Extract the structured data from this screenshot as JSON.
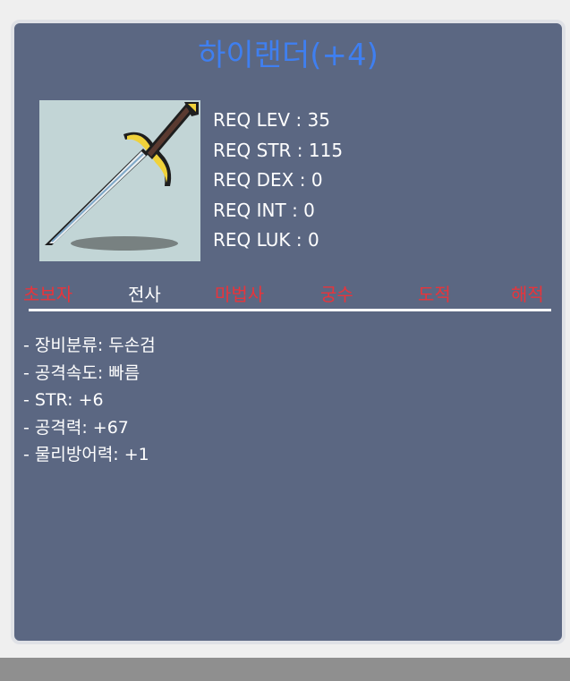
{
  "item": {
    "name": "하이랜더(+4)",
    "name_color": "#3f7ff0",
    "icon": "two-handed-sword-icon"
  },
  "requirements": [
    "REQ LEV : 35",
    "REQ STR : 115",
    "REQ DEX : 0",
    "REQ INT : 0",
    "REQ LUK : 0"
  ],
  "jobs": [
    {
      "label": "초보자",
      "color": "#e8343b"
    },
    {
      "label": "전사",
      "color": "#ffffff"
    },
    {
      "label": "마법사",
      "color": "#e8343b"
    },
    {
      "label": "궁수",
      "color": "#e8343b"
    },
    {
      "label": "도적",
      "color": "#e8343b"
    },
    {
      "label": "해적",
      "color": "#e8343b"
    }
  ],
  "stats": [
    "- 장비분류: 두손검",
    "- 공격속도: 빠름",
    "- STR: +6",
    "- 공격력: +67",
    "- 물리방어력: +1"
  ],
  "colors": {
    "panel_bg": "#5b6782",
    "image_bg": "#c2d5d6",
    "available": "#ffffff",
    "unavailable": "#e8343b"
  }
}
